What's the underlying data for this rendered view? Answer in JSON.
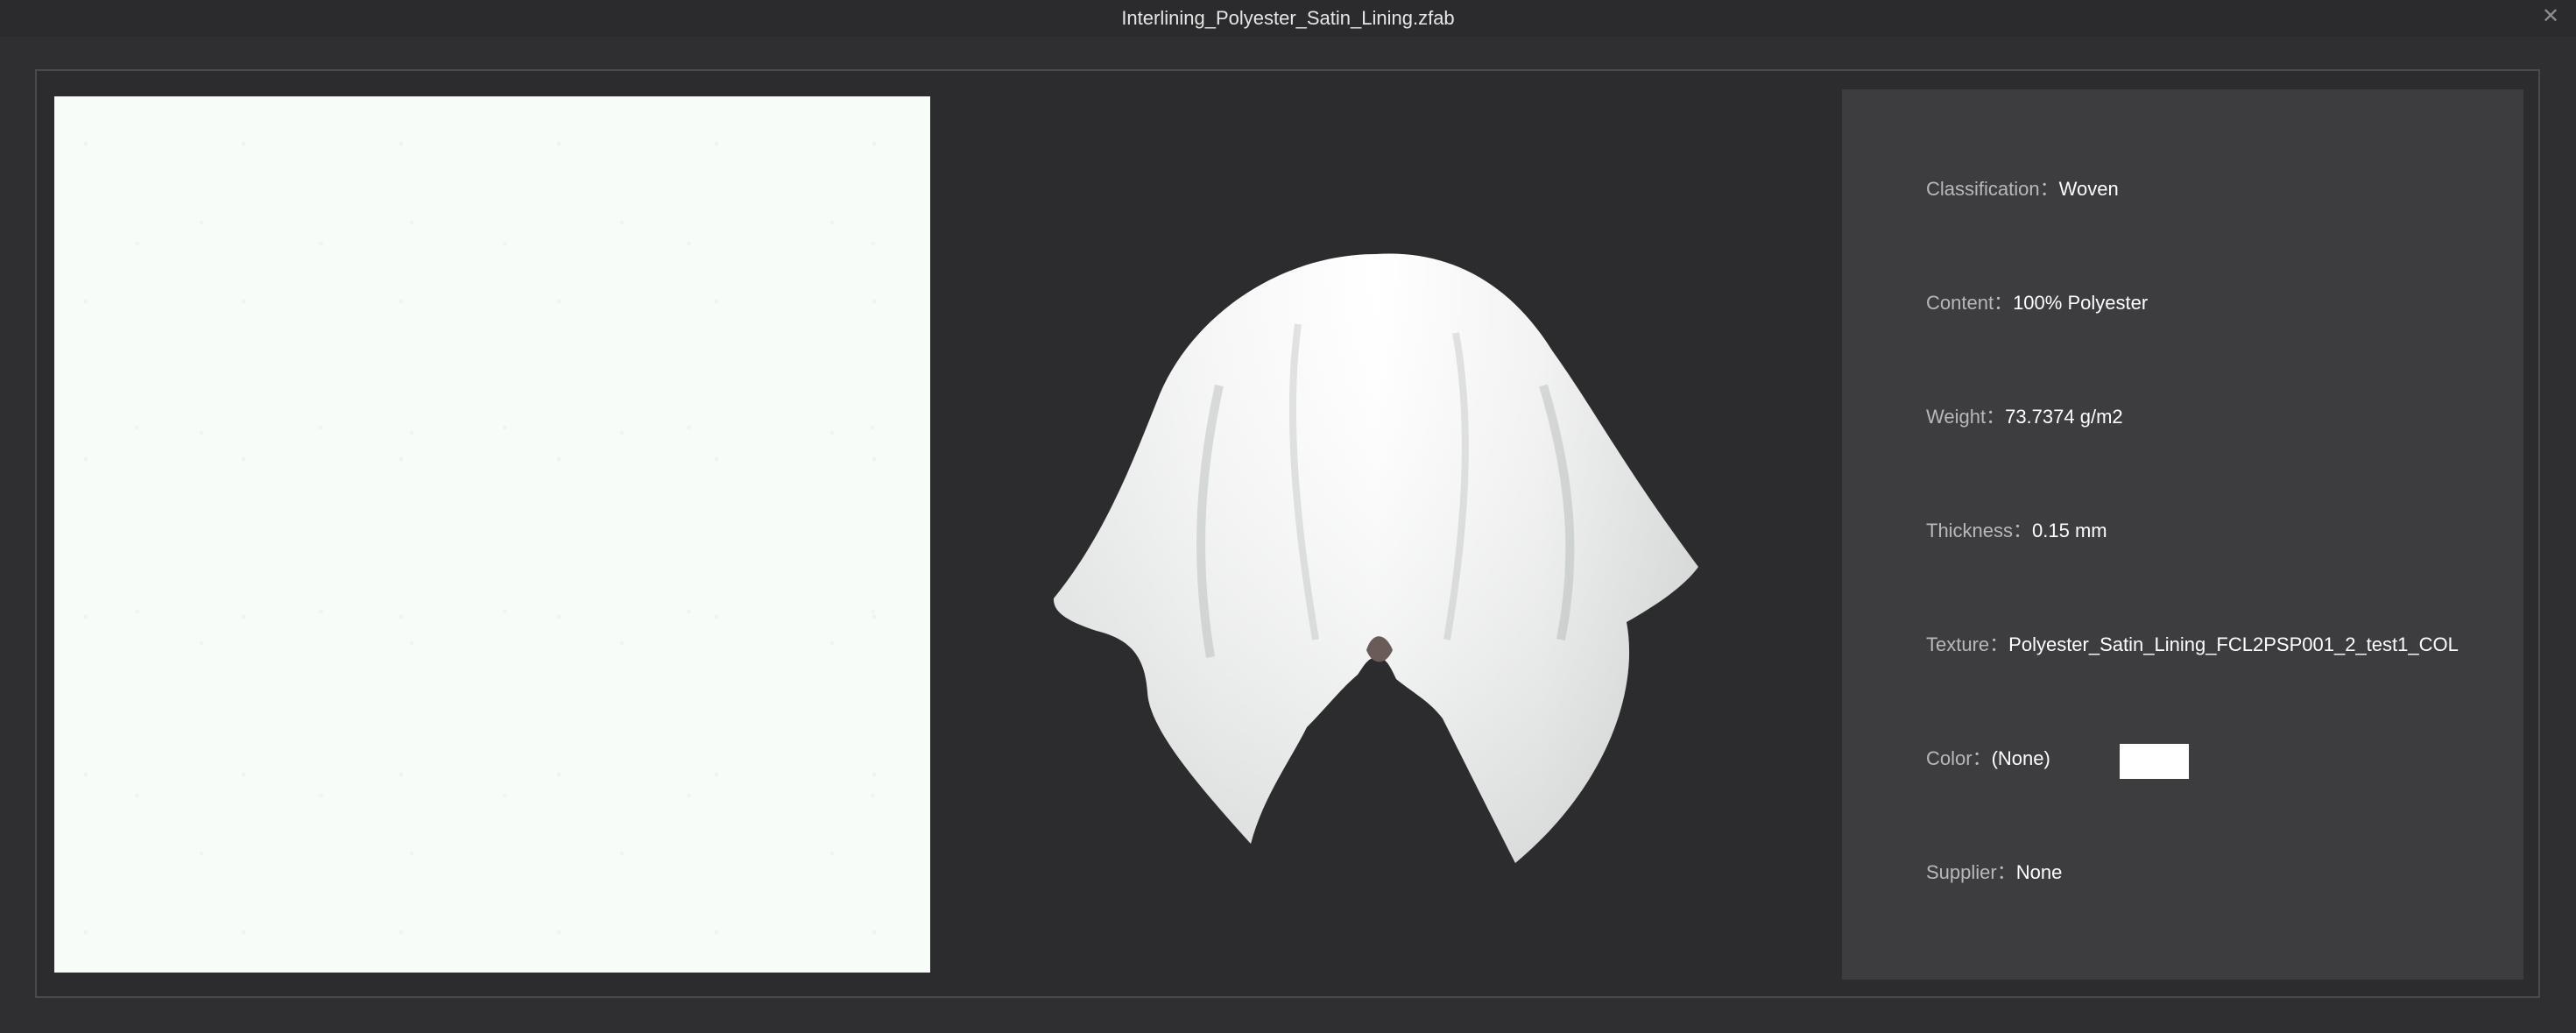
{
  "window": {
    "title": "Interlining_Polyester_Satin_Lining.zfab",
    "close_glyph": "✕"
  },
  "fabric_info": {
    "classification": {
      "label": "Classification：",
      "value": "Woven"
    },
    "content": {
      "label": "Content：",
      "value": "100% Polyester"
    },
    "weight": {
      "label": "Weight：",
      "value": "73.7374 g/m2"
    },
    "thickness": {
      "label": "Thickness：",
      "value": "0.15 mm"
    },
    "texture": {
      "label": "Texture：",
      "value": "Polyester_Satin_Lining_FCL2PSP001_2_test1_COL"
    },
    "color": {
      "label": "Color：",
      "value": "(None)",
      "swatch_color": "#ffffff"
    },
    "supplier": {
      "label": "Supplier：",
      "value": "None"
    }
  },
  "colors": {
    "background": "#2f2f31",
    "titlebar": "#2b2b2d",
    "info_panel": "#3d3d40",
    "texture_fill": "#f7fcf9"
  }
}
